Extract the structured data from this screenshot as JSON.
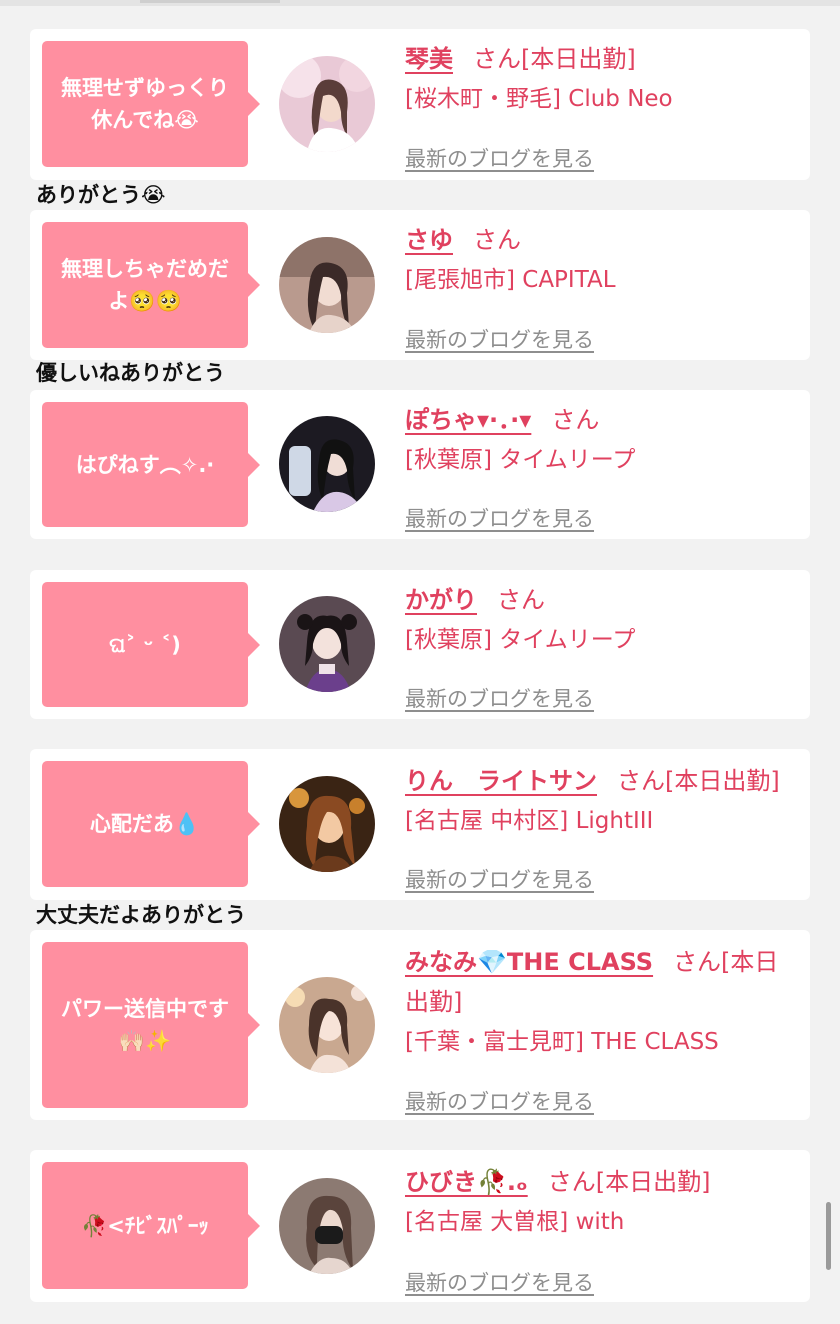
{
  "posts": [
    {
      "message": "無理せずゆっくり\n休んでね😭",
      "name": "琴美",
      "suffix": "さん[本日出勤]",
      "shop": "[桜木町・野毛] Club Neo",
      "blog": "最新のブログを見る",
      "avatar_colors": [
        "#e9c9d6",
        "#f6e2ea",
        "#5b3d3a"
      ]
    },
    {
      "message": "無理しちゃだめだ\nよ🥺🥺",
      "name": "さゆ",
      "suffix": "さん",
      "shop": "[尾張旭市] CAPITAL",
      "blog": "最新のブログを見る",
      "avatar_colors": [
        "#b99a8e",
        "#e7d3ca",
        "#3b2a28"
      ]
    },
    {
      "message": "はぴねす︵✧.·",
      "name": "ぽちゃ▾·．·▾",
      "suffix": "さん",
      "shop": "[秋葉原] タイムリープ",
      "blog": "最新のブログを見る",
      "avatar_colors": [
        "#1c1a22",
        "#d9c8e6",
        "#111111"
      ]
    },
    {
      "message": "ଘ˃ ᵕ ˂)",
      "name": "かがり",
      "suffix": "さん",
      "shop": "[秋葉原] タイムリープ",
      "blog": "最新のブログを見る",
      "avatar_colors": [
        "#5a4a52",
        "#efe3e8",
        "#1a1416"
      ]
    },
    {
      "message": "心配だあ💧",
      "name": "りん　ライトサン",
      "suffix": "さん[本日出勤]",
      "shop": "[名古屋 中村区] LightIII",
      "blog": "最新のブログを見る",
      "avatar_colors": [
        "#6b3a1c",
        "#f3c9a3",
        "#8a4a22"
      ]
    },
    {
      "message": "パワー送信中です\n🙌🏻✨",
      "name": "みなみ💎THE CLASS",
      "suffix": "さん[本日出勤]",
      "shop": "[千葉・富士見町] THE CLASS",
      "blog": "最新のブログを見る",
      "avatar_colors": [
        "#c9a890",
        "#f4e2d8",
        "#4a332a"
      ]
    },
    {
      "message": "🥀<ﾁﾋﾞｽﾊﾟｰｯ",
      "name": "ひびき🥀.ₒ",
      "suffix": "さん[本日出勤]",
      "shop": "[名古屋 大曽根] with",
      "blog": "最新のブログを見る",
      "avatar_colors": [
        "#8c7a72",
        "#e6d6cf",
        "#1b1b1b"
      ]
    }
  ],
  "replies": [
    "ありがとう😭",
    "優しいねありがとう",
    "大丈夫だよありがとう"
  ]
}
